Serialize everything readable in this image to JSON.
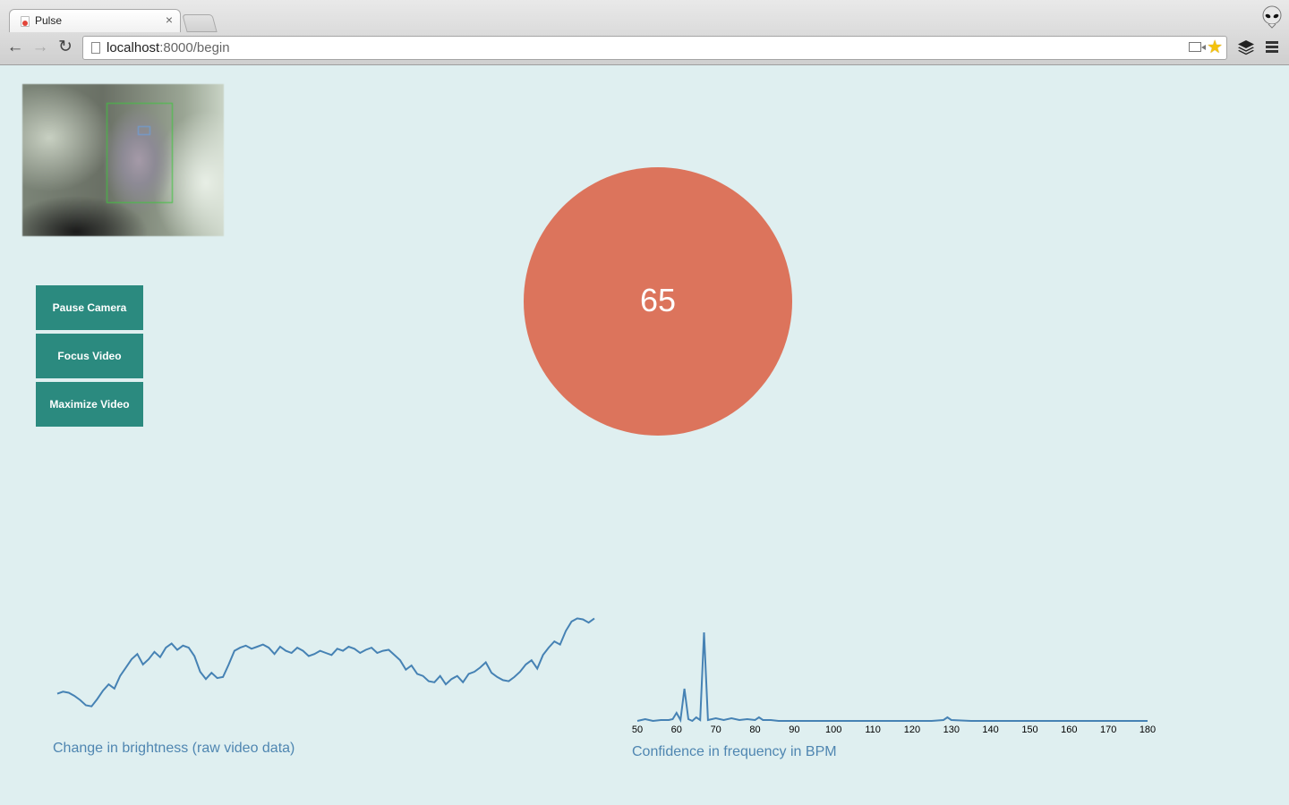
{
  "browser": {
    "tab_title": "Pulse",
    "tab_close": "×",
    "url_host": "localhost",
    "url_path": ":8000/begin",
    "back_glyph": "←",
    "forward_glyph": "→",
    "reload_glyph": "↻"
  },
  "buttons": {
    "pause_camera": "Pause Camera",
    "focus_video": "Focus Video",
    "maximize_video": "Maximize Video"
  },
  "heart_rate": {
    "value": "65",
    "color": "#dc745c"
  },
  "colors": {
    "background": "#dfeff0",
    "button": "#2b8a7f",
    "line": "#4682b4",
    "caption": "#4f86b1"
  },
  "chart_data": [
    {
      "type": "line",
      "title": "",
      "xlabel": "Change in brightness (raw video data)",
      "ylabel": "",
      "x_axis": "none",
      "y_range": [
        0,
        1
      ],
      "values": [
        0.14,
        0.16,
        0.15,
        0.12,
        0.08,
        0.03,
        0.02,
        0.09,
        0.17,
        0.23,
        0.19,
        0.31,
        0.39,
        0.47,
        0.52,
        0.42,
        0.47,
        0.54,
        0.49,
        0.58,
        0.62,
        0.56,
        0.6,
        0.58,
        0.5,
        0.35,
        0.28,
        0.34,
        0.29,
        0.3,
        0.42,
        0.55,
        0.58,
        0.6,
        0.57,
        0.59,
        0.61,
        0.58,
        0.52,
        0.59,
        0.55,
        0.53,
        0.58,
        0.55,
        0.5,
        0.52,
        0.55,
        0.53,
        0.51,
        0.57,
        0.55,
        0.59,
        0.57,
        0.53,
        0.56,
        0.58,
        0.53,
        0.55,
        0.56,
        0.51,
        0.46,
        0.37,
        0.41,
        0.33,
        0.31,
        0.26,
        0.25,
        0.31,
        0.23,
        0.28,
        0.31,
        0.25,
        0.33,
        0.35,
        0.39,
        0.44,
        0.34,
        0.3,
        0.27,
        0.26,
        0.3,
        0.35,
        0.42,
        0.46,
        0.38,
        0.51,
        0.58,
        0.64,
        0.61,
        0.74,
        0.83,
        0.86,
        0.85,
        0.82,
        0.86
      ]
    },
    {
      "type": "line",
      "title": "",
      "xlabel": "Confidence in frequency in BPM",
      "ylabel": "",
      "x_ticks": [
        50,
        60,
        70,
        80,
        90,
        100,
        110,
        120,
        130,
        140,
        150,
        160,
        170,
        180
      ],
      "xlim": [
        50,
        180
      ],
      "ylim": [
        0,
        1
      ],
      "x": [
        50,
        52,
        54,
        56,
        58,
        59,
        60,
        61,
        62,
        63,
        64,
        65,
        66,
        67,
        68,
        70,
        72,
        74,
        76,
        78,
        80,
        81,
        82,
        84,
        86,
        88,
        90,
        95,
        100,
        105,
        110,
        115,
        120,
        125,
        128,
        129,
        130,
        135,
        140,
        145,
        150,
        155,
        160,
        165,
        170,
        175,
        180
      ],
      "y": [
        0.01,
        0.03,
        0.01,
        0.02,
        0.02,
        0.03,
        0.1,
        0.02,
        0.37,
        0.03,
        0.01,
        0.05,
        0.02,
        1.0,
        0.02,
        0.04,
        0.02,
        0.04,
        0.02,
        0.03,
        0.02,
        0.05,
        0.02,
        0.02,
        0.01,
        0.01,
        0.01,
        0.01,
        0.01,
        0.01,
        0.01,
        0.01,
        0.01,
        0.01,
        0.02,
        0.05,
        0.02,
        0.01,
        0.01,
        0.01,
        0.01,
        0.01,
        0.01,
        0.01,
        0.01,
        0.01,
        0.01
      ]
    }
  ]
}
